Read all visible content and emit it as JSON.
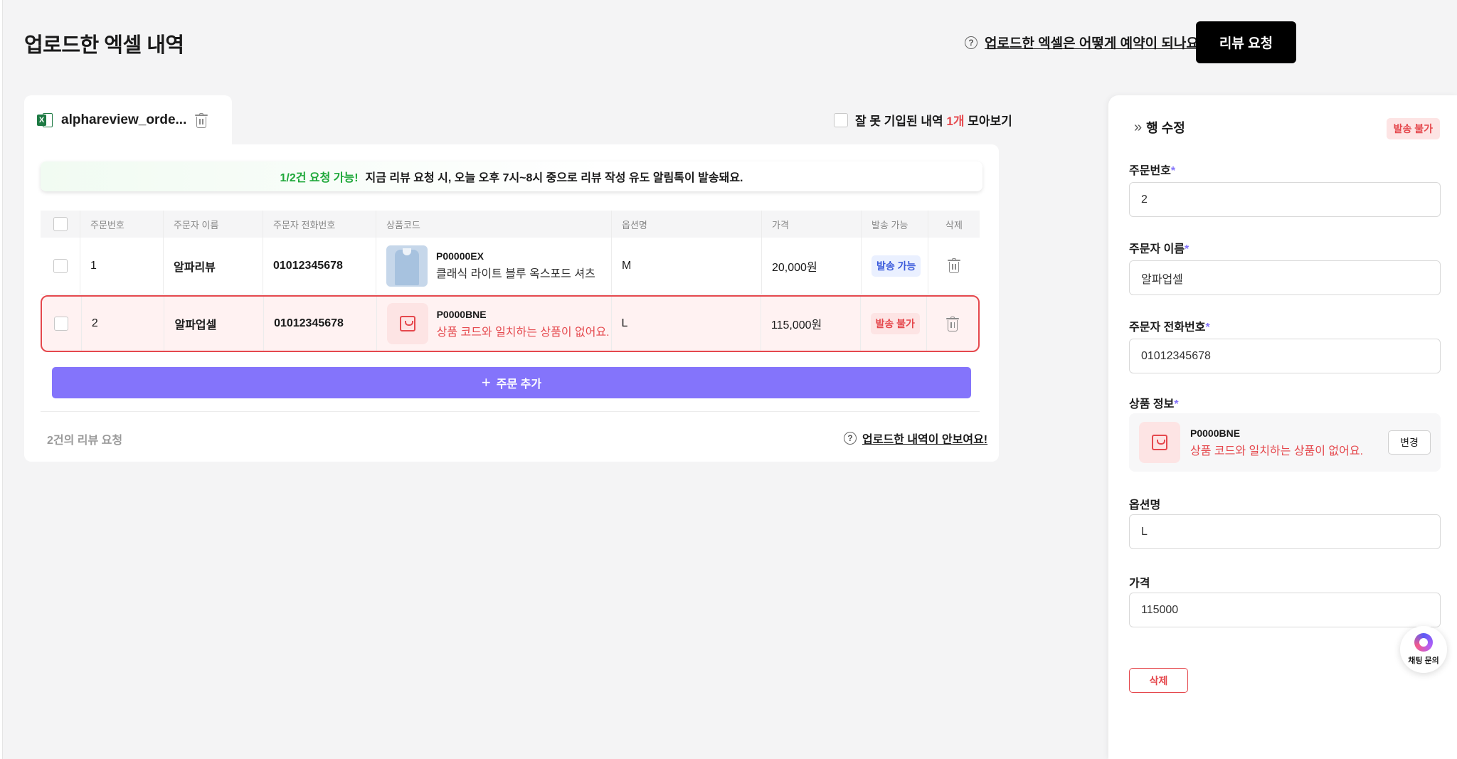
{
  "header": {
    "title": "업로드한 엑셀 내역",
    "help_link": "업로드한 엑셀은 어떻게 예약이 되나요?",
    "review_button": "리뷰 요청"
  },
  "file": {
    "name": "alphareview_orde...",
    "icon": "excel-icon"
  },
  "filter": {
    "prefix": "잘 못 기입된 내역",
    "count": "1개",
    "suffix": "모아보기"
  },
  "notice": {
    "highlight": "1/2건 요청 가능!",
    "message": "지금 리뷰 요청 시, 오늘 오후 7시~8시 중으로 리뷰 작성 유도 알림톡이 발송돼요."
  },
  "table": {
    "headers": [
      "주문번호",
      "주문자 이름",
      "주문자 전화번호",
      "상품코드",
      "옵션명",
      "가격",
      "발송 가능",
      "삭제"
    ],
    "rows": [
      {
        "order_no": "1",
        "name": "알파리뷰",
        "phone": "01012345678",
        "product_code": "P00000EX",
        "product_name": "클래식 라이트 블루 옥스포드 셔츠",
        "option": "M",
        "price": "20,000원",
        "status": "발송 가능"
      },
      {
        "order_no": "2",
        "name": "알파업셀",
        "phone": "01012345678",
        "product_code": "P0000BNE",
        "product_name": "상품 코드와 일치하는 상품이 없어요.",
        "option": "L",
        "price": "115,000원",
        "status": "발송 불가"
      }
    ]
  },
  "add_order_button": "주문 추가",
  "footer": {
    "count": "2건의 리뷰 요청",
    "help_link": "업로드한 내역이 안보여요!"
  },
  "panel": {
    "title": "행 수정",
    "status_badge": "발송 불가",
    "fields": {
      "order_no": {
        "label": "주문번호",
        "value": "2"
      },
      "name": {
        "label": "주문자 이름",
        "value": "알파업셀"
      },
      "phone": {
        "label": "주문자 전화번호",
        "value": "01012345678"
      },
      "product": {
        "label": "상품 정보",
        "code": "P0000BNE",
        "message": "상품 코드와 일치하는 상품이 없어요.",
        "change_button": "변경"
      },
      "option": {
        "label": "옵션명",
        "value": "L"
      },
      "price": {
        "label": "가격",
        "value": "115000"
      }
    },
    "required_mark": "*",
    "delete_button": "삭제"
  },
  "chat": {
    "label": "채팅 문의"
  },
  "colors": {
    "accent": "#8474fb",
    "error": "#e5484d",
    "success": "#1fa83a",
    "ok_badge": "#3b5bdb"
  }
}
